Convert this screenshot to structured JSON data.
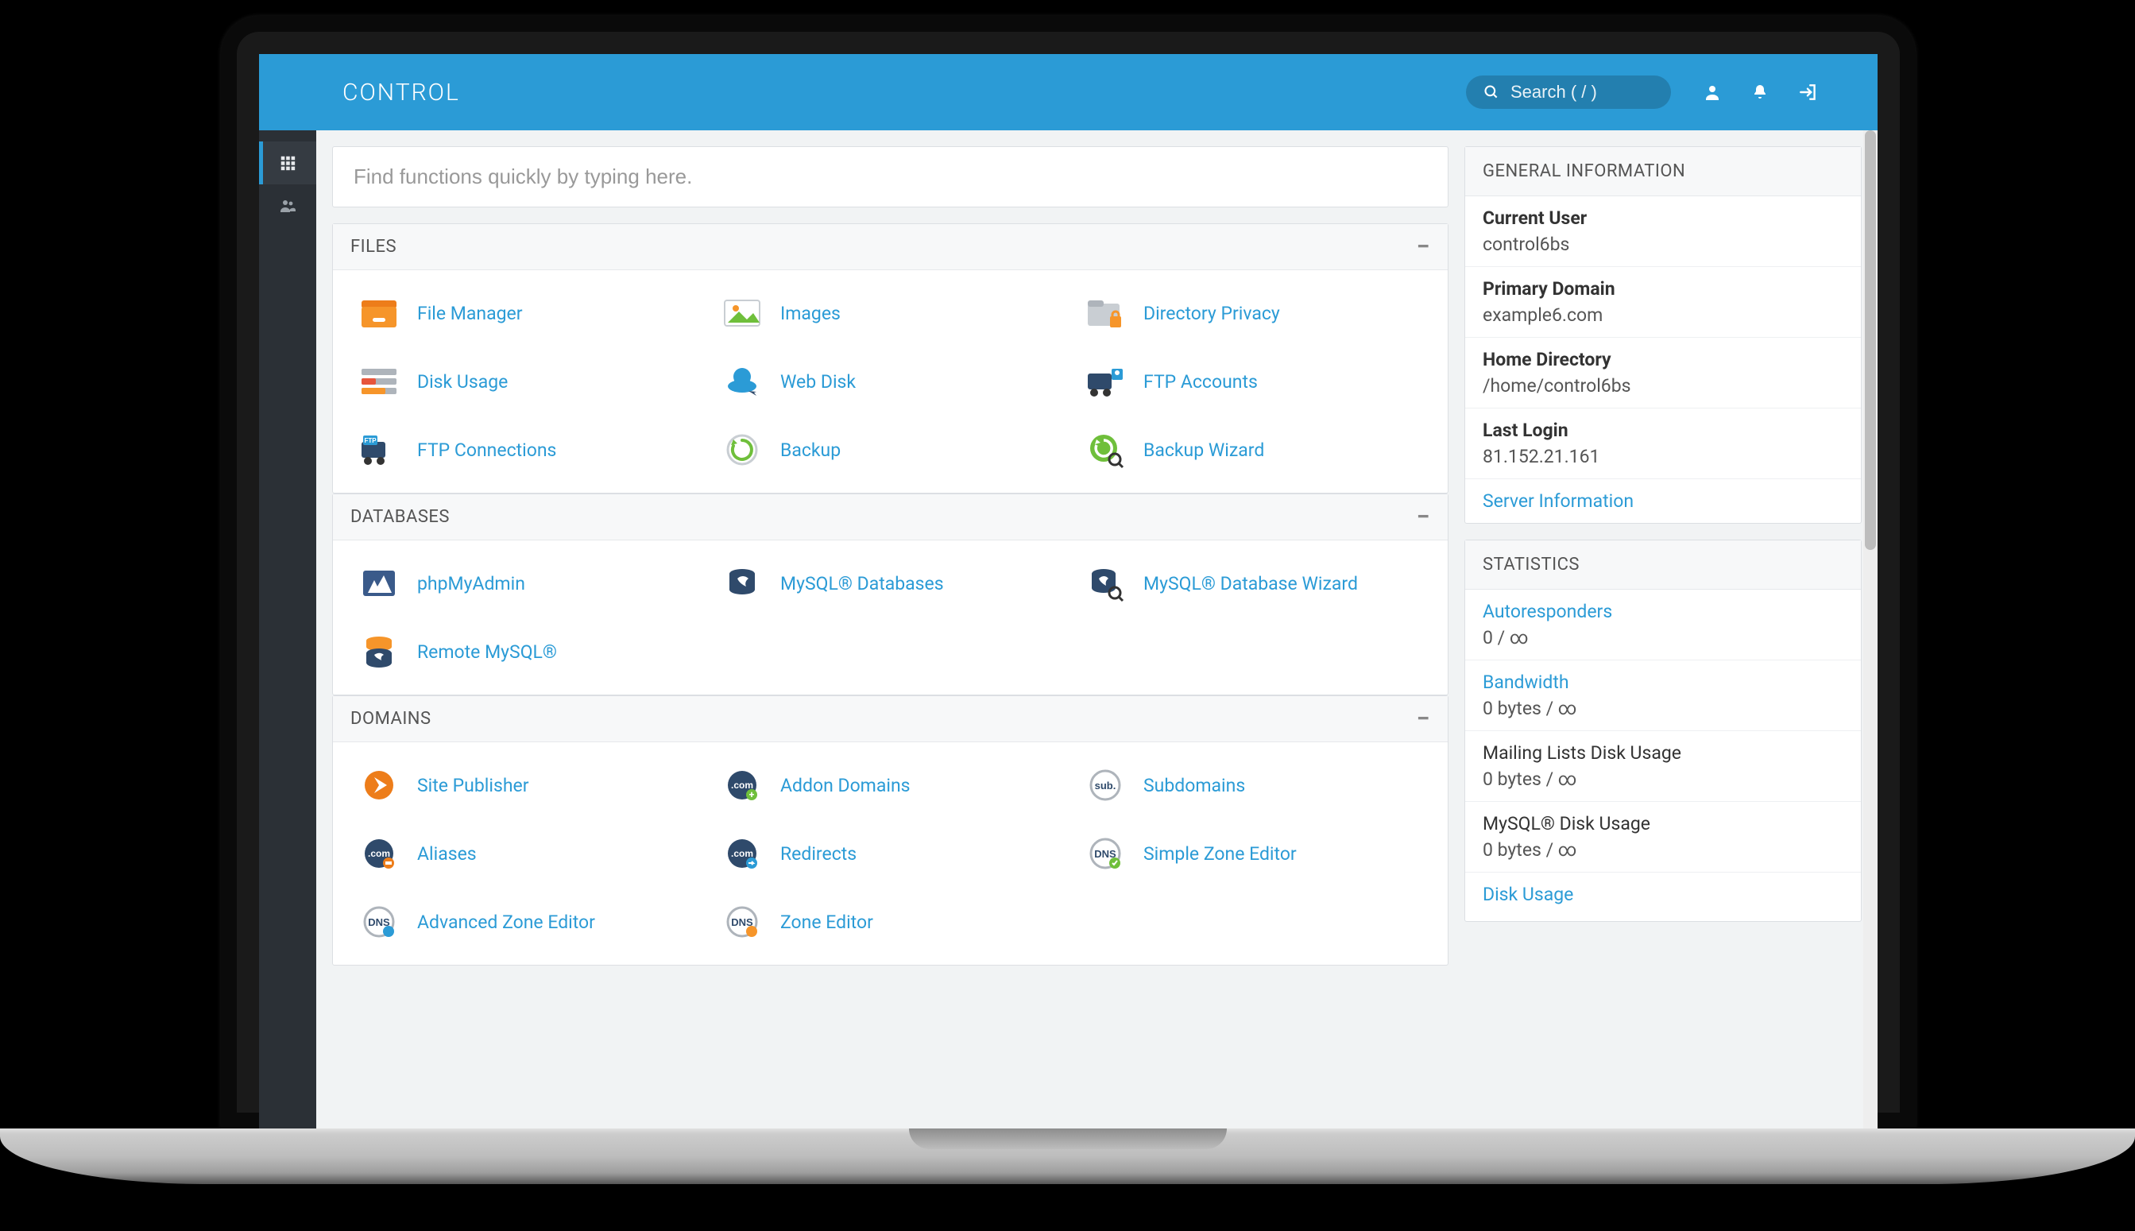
{
  "brand": "CONTROL",
  "search": {
    "placeholder": "Search ( / )"
  },
  "find": {
    "placeholder": "Find functions quickly by typing here."
  },
  "sections": {
    "files": {
      "title": "FILES",
      "items": [
        {
          "label": "File Manager",
          "name": "file-manager"
        },
        {
          "label": "Images",
          "name": "images"
        },
        {
          "label": "Directory Privacy",
          "name": "directory-privacy"
        },
        {
          "label": "Disk Usage",
          "name": "disk-usage"
        },
        {
          "label": "Web Disk",
          "name": "web-disk"
        },
        {
          "label": "FTP Accounts",
          "name": "ftp-accounts"
        },
        {
          "label": "FTP Connections",
          "name": "ftp-connections"
        },
        {
          "label": "Backup",
          "name": "backup"
        },
        {
          "label": "Backup Wizard",
          "name": "backup-wizard"
        }
      ]
    },
    "databases": {
      "title": "DATABASES",
      "items": [
        {
          "label": "phpMyAdmin",
          "name": "phpmyadmin"
        },
        {
          "label": "MySQL® Databases",
          "name": "mysql-databases"
        },
        {
          "label": "MySQL® Database Wizard",
          "name": "mysql-database-wizard"
        },
        {
          "label": "Remote MySQL®",
          "name": "remote-mysql"
        }
      ]
    },
    "domains": {
      "title": "DOMAINS",
      "items": [
        {
          "label": "Site Publisher",
          "name": "site-publisher"
        },
        {
          "label": "Addon Domains",
          "name": "addon-domains"
        },
        {
          "label": "Subdomains",
          "name": "subdomains"
        },
        {
          "label": "Aliases",
          "name": "aliases"
        },
        {
          "label": "Redirects",
          "name": "redirects"
        },
        {
          "label": "Simple Zone Editor",
          "name": "simple-zone-editor"
        },
        {
          "label": "Advanced Zone Editor",
          "name": "advanced-zone-editor"
        },
        {
          "label": "Zone Editor",
          "name": "zone-editor"
        }
      ]
    }
  },
  "general": {
    "title": "GENERAL INFORMATION",
    "rows": [
      {
        "label": "Current User",
        "value": "control6bs"
      },
      {
        "label": "Primary Domain",
        "value": "example6.com"
      },
      {
        "label": "Home Directory",
        "value": "/home/control6bs"
      },
      {
        "label": "Last Login",
        "value": "81.152.21.161"
      }
    ],
    "link": "Server Information"
  },
  "stats": {
    "title": "STATISTICS",
    "rows": [
      {
        "label": "Autoresponders",
        "value": "0 / ∞",
        "link": true
      },
      {
        "label": "Bandwidth",
        "value": "0 bytes / ∞",
        "link": true
      },
      {
        "label": "Mailing Lists Disk Usage",
        "value": "0 bytes / ∞",
        "link": false
      },
      {
        "label": "MySQL® Disk Usage",
        "value": "0 bytes / ∞",
        "link": false
      },
      {
        "label": "Disk Usage",
        "value": "",
        "link": true
      }
    ]
  }
}
